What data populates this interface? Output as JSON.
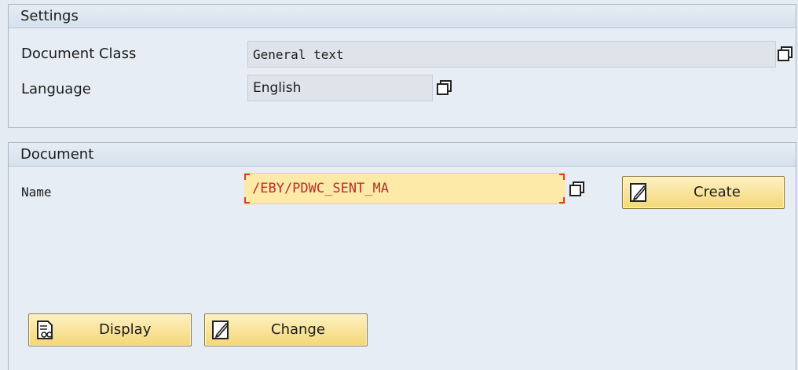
{
  "settings": {
    "title": "Settings",
    "document_class_label": "Document Class",
    "document_class_value": "General text",
    "language_label": "Language",
    "language_value": "English"
  },
  "document": {
    "title": "Document",
    "name_label": "Name",
    "name_value": "/EBY/PDWC_SENT_MA",
    "create_label": "Create",
    "display_label": "Display",
    "change_label": "Change"
  },
  "icons": {
    "value_help": "value-help-icon",
    "create": "pencil-edit-icon",
    "display": "document-glasses-icon",
    "change": "pencil-edit-icon"
  },
  "colors": {
    "background": "#e5ebf2",
    "button_fill": "#f5d777",
    "required_field_fill": "#fde9a8",
    "required_marker": "#e03a2a",
    "input_text": "#b4312c"
  }
}
